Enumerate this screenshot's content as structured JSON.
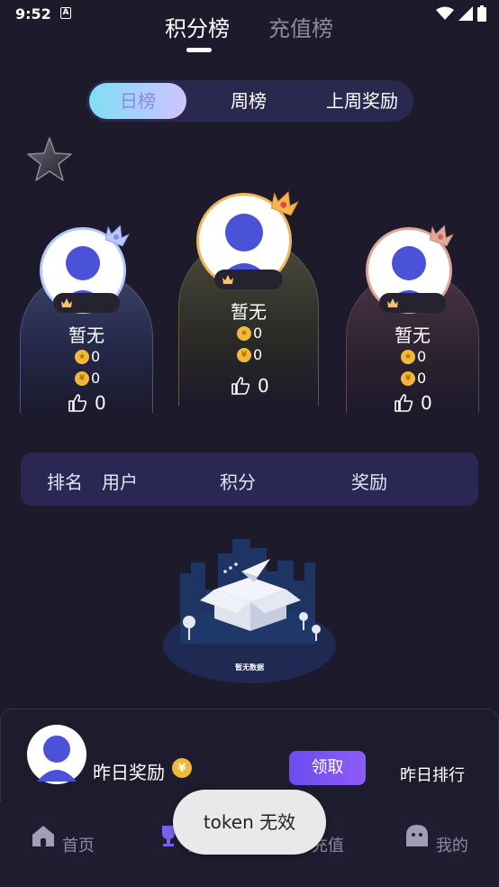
{
  "status_bar": {
    "time": "9:52",
    "a_badge": "A"
  },
  "top_tabs": {
    "active": "积分榜",
    "inactive": "充值榜"
  },
  "period_tabs": {
    "daily": "日榜",
    "weekly": "周榜",
    "last_week_reward": "上周奖励"
  },
  "podium": {
    "left": {
      "name": "暂无",
      "points": "0",
      "coins": "0",
      "likes": "0"
    },
    "center": {
      "name": "暂无",
      "points": "0",
      "coins": "0",
      "likes": "0"
    },
    "right": {
      "name": "暂无",
      "points": "0",
      "coins": "0",
      "likes": "0"
    }
  },
  "table_header": {
    "rank": "排名",
    "user": "用户",
    "score": "积分",
    "reward": "奖励"
  },
  "empty_state": {
    "text": "暂无数据"
  },
  "bottom_card": {
    "yesterday_reward": "昨日奖励",
    "coin_symbol": "¥",
    "claim": "领取",
    "yesterday_rank": "昨日排行"
  },
  "toast": {
    "text": "token 无效"
  },
  "tabbar": {
    "home": "首页",
    "rank": "排行",
    "recharge": "充值",
    "mine": "我的"
  },
  "colors": {
    "accent": "#7a62f0",
    "background": "#1c1a2b",
    "gold": "#f1b93b"
  }
}
